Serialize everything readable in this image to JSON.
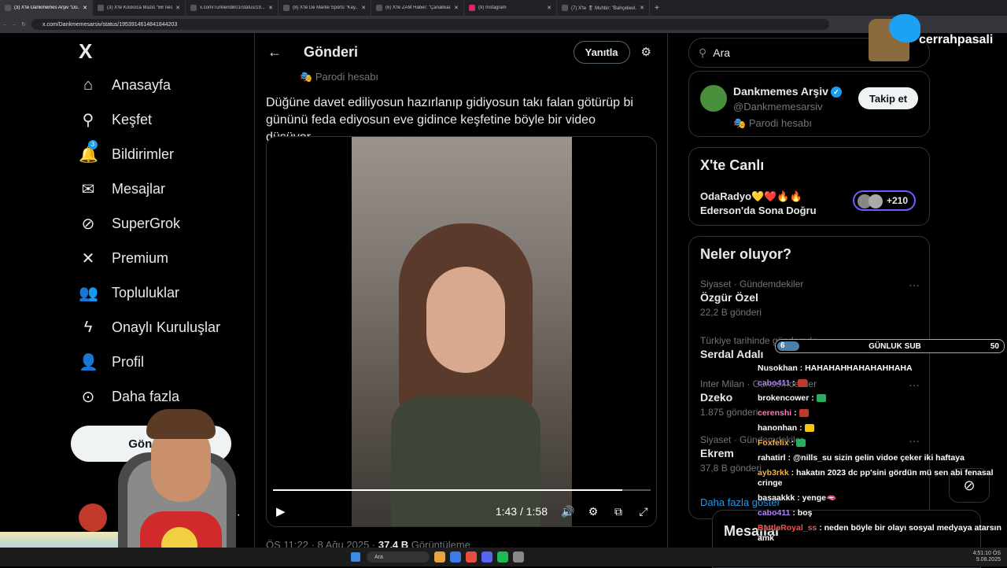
{
  "browser": {
    "tabs": [
      {
        "label": "(3) X'te Dankmemes Arşiv \"Dü...",
        "active": true
      },
      {
        "label": "(3) X'te Koskoca Mazis \"Bir nes...",
        "active": false
      },
      {
        "label": "x.com/Turklendik01/status/19...",
        "active": false
      },
      {
        "label": "(8) X'te De Marke Sports \"Kay...",
        "active": false
      },
      {
        "label": "(6) X'te ZAM Haber: \"Çanakkal...",
        "active": false
      },
      {
        "label": "(9) Instagram",
        "active": false
      },
      {
        "label": "(7) X'te 🎖 Muhbir: \"Bahçelievl...",
        "active": false
      }
    ],
    "new_tab": "+",
    "url": "x.com/Dankmemesarsiv/status/1953914614841844203"
  },
  "sidebar": {
    "logo": "X",
    "items": [
      {
        "label": "Anasayfa",
        "icon": "home-icon",
        "glyph": "⌂"
      },
      {
        "label": "Keşfet",
        "icon": "search-icon",
        "glyph": "⚲"
      },
      {
        "label": "Bildirimler",
        "icon": "bell-icon",
        "glyph": "🔔",
        "badge": "3"
      },
      {
        "label": "Mesajlar",
        "icon": "mail-icon",
        "glyph": "✉"
      },
      {
        "label": "SuperGrok",
        "icon": "grok-icon",
        "glyph": "⊘"
      },
      {
        "label": "Premium",
        "icon": "x-premium-icon",
        "glyph": "✕"
      },
      {
        "label": "Topluluklar",
        "icon": "communities-icon",
        "glyph": "👥"
      },
      {
        "label": "Onaylı Kuruluşlar",
        "icon": "lightning-icon",
        "glyph": "ϟ"
      },
      {
        "label": "Profil",
        "icon": "profile-icon",
        "glyph": "👤"
      },
      {
        "label": "Daha fazla",
        "icon": "more-circle-icon",
        "glyph": "⊙"
      }
    ],
    "post_button": "Gönderi",
    "profile_dots": "···"
  },
  "post": {
    "header_title": "Gönderi",
    "reply_button": "Yanıtla",
    "parody_label": "Parodi hesabı",
    "text": "Düğüne davet ediliyosun hazırlanıp gidiyosun takı falan götürüp bi gününü feda ediyosun eve gidince keşfetine böyle bir video düşüyor",
    "video": {
      "time": "1:43 / 1:58",
      "progress": 0.924
    },
    "meta_time": "ÖS 11:22 · 8 Ağu 2025 · ",
    "meta_views": "37,4 B",
    "meta_views_label": " Görüntüleme"
  },
  "right": {
    "search_placeholder": "Ara",
    "account": {
      "name": "Dankmemes Arşiv",
      "handle": "@Dankmemesarsiv",
      "parody": "Parodi hesabı",
      "follow_button": "Takip et"
    },
    "live": {
      "title": "X'te Canlı",
      "line1": "OdaRadyo💛❤️🔥🔥",
      "line2": "Ederson'da Sona Doğru",
      "count": "+210"
    },
    "trends": {
      "title": "Neler oluyor?",
      "items": [
        {
          "category": "Siyaset · Gündemdekiler",
          "name": "Özgür Özel",
          "count": "22,2 B gönderi"
        },
        {
          "category": "Türkiye tarihinde gündemde",
          "name": "Serdal Adalı",
          "count": ""
        },
        {
          "category": "Inter Milan · Gündemdekiler",
          "name": "Dzeko",
          "count": "1.875 gönderi"
        },
        {
          "category": "Siyaset · Gündemdekiler",
          "name": "Ekrem",
          "count": "37,8 B gönderi"
        }
      ],
      "show_more": "Daha fazla göster"
    },
    "messages_title": "Mesajlar"
  },
  "overlay": {
    "brand": "cerrahpasali",
    "sub_count": "6",
    "sub_label": "GÜNLUK SUB",
    "sub_goal": "50",
    "chat": [
      {
        "user": "Nusokhan",
        "color": "#ffffff",
        "msg": " : HAHAHAHHAHAHAHHAHA"
      },
      {
        "user": "cabo411",
        "color": "#b583ff",
        "msg": " : ",
        "emote": "#c0392b"
      },
      {
        "user": "brokencower",
        "color": "#ffffff",
        "msg": " : ",
        "emote": "#27ae60"
      },
      {
        "user": "cerenshi",
        "color": "#ff7ab6",
        "msg": " : ",
        "emote": "#c0392b"
      },
      {
        "user": "hanonhan",
        "color": "#ffffff",
        "msg": " : ",
        "emote": "#f1c40f"
      },
      {
        "user": "Foxfelix",
        "color": "#f5b041",
        "msg": " : ",
        "emote": "#27ae60"
      },
      {
        "user": "rahatirl",
        "color": "#ffffff",
        "msg": " : @nills_su sizin gelin vidoe çeker iki haftaya"
      },
      {
        "user": "ayb3rkk",
        "color": "#f5b041",
        "msg": " : hakatın 2023 dc pp'sini gördün mü sen abi fenasal cringe"
      },
      {
        "user": "basaakkk",
        "color": "#ffffff",
        "msg": " : yenge🫦"
      },
      {
        "user": "cabo411",
        "color": "#b583ff",
        "msg": " : boş"
      },
      {
        "user": "BattleRoyal_ss",
        "color": "#ff4d4d",
        "msg": " : neden böyle bir olayı sosyal medyaya atarsın amk"
      }
    ]
  },
  "taskbar": {
    "search": "Ara",
    "time": "4:51:10 ÖS",
    "date": "9.08.2025"
  }
}
